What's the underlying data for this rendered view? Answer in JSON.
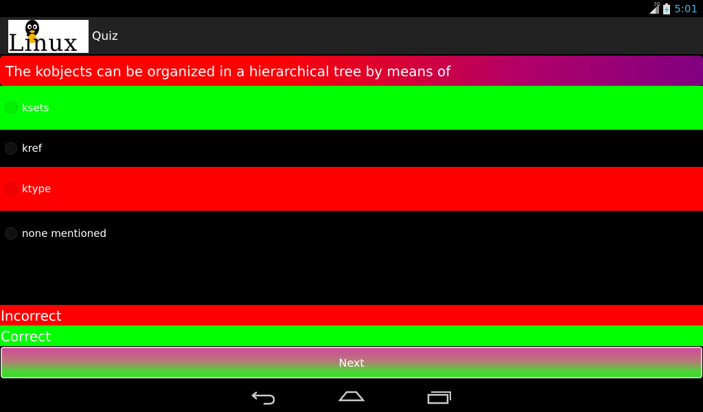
{
  "status_bar": {
    "network_type": "3G",
    "time": "5:01",
    "icons": {
      "signal": "signal-icon",
      "battery": "battery-charging-icon"
    },
    "clock_color": "#33b5e5"
  },
  "action_bar": {
    "logo_text": "Linux",
    "title": "Quiz"
  },
  "question": {
    "text": "The kobjects can be organized in a hierarchical tree by means of"
  },
  "options": [
    {
      "label": "ksets",
      "bg": "#00ff00"
    },
    {
      "label": "kref",
      "bg": "#000000"
    },
    {
      "label": "ktype",
      "bg": "#ff0000"
    },
    {
      "label": "none mentioned",
      "bg": "#000000"
    }
  ],
  "feedback": {
    "incorrect": "Incorrect",
    "correct": "Correct",
    "incorrect_color": "#ff0000",
    "correct_color": "#00ff00"
  },
  "next_button": {
    "label": "Next"
  },
  "nav_bar": {
    "icons": [
      "back-icon",
      "home-icon",
      "recent-apps-icon"
    ]
  }
}
